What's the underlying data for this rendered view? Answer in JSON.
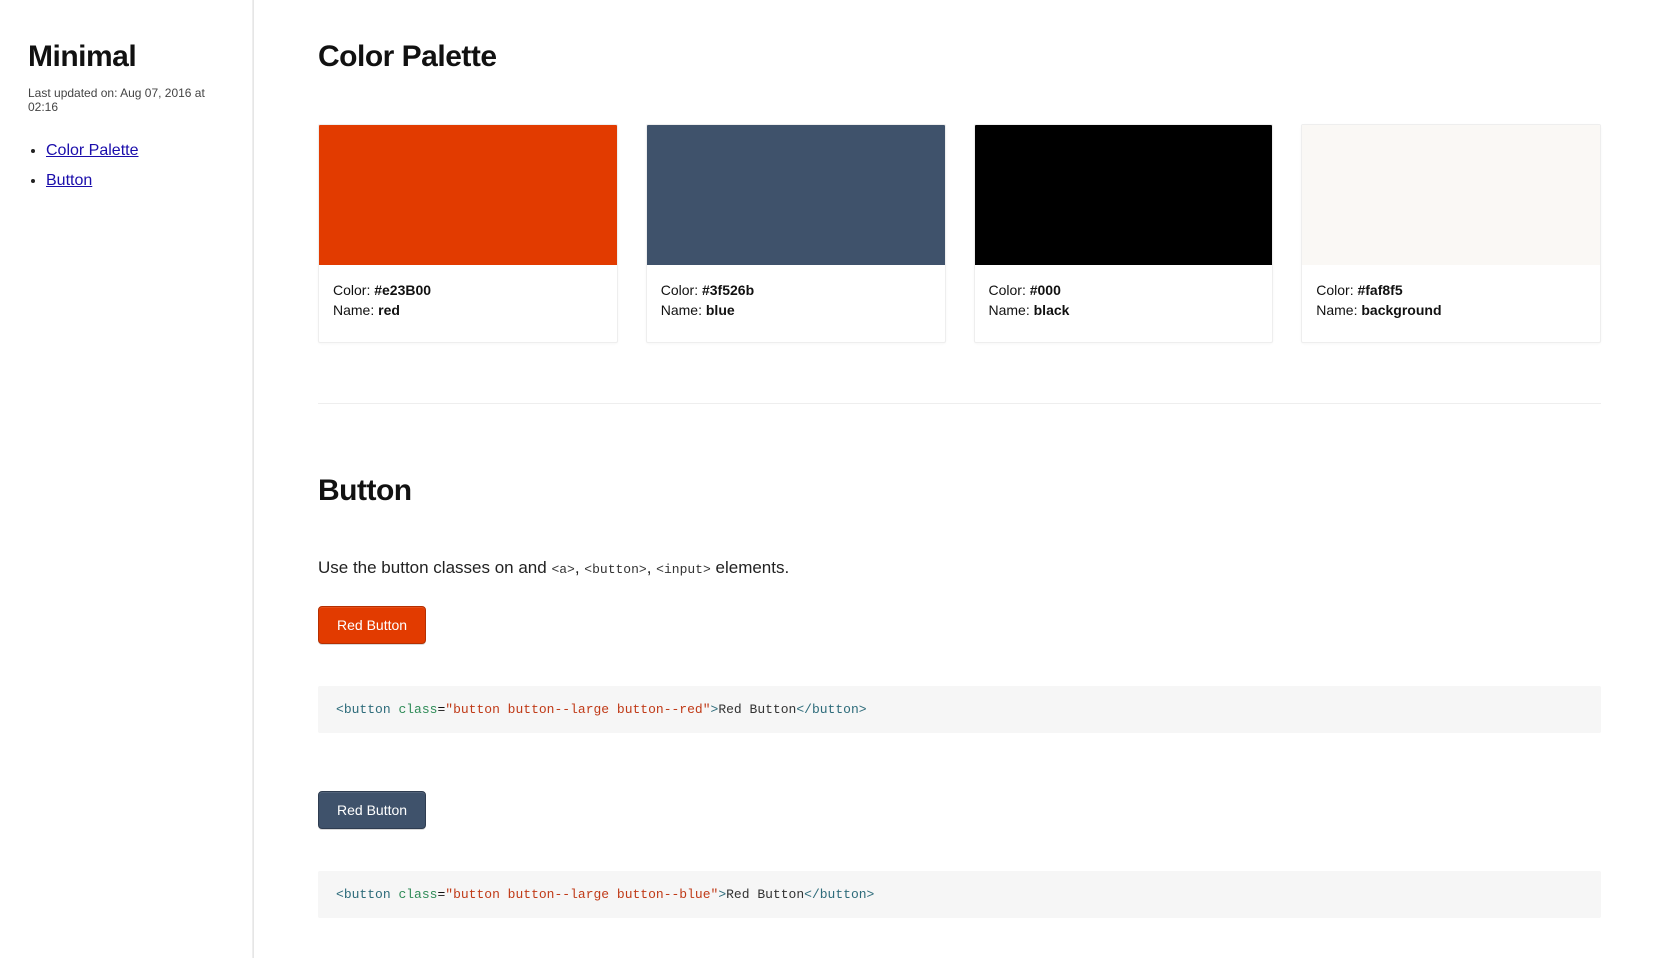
{
  "sidebar": {
    "title": "Minimal",
    "updated": "Last updated on: Aug 07, 2016 at 02:16",
    "nav": [
      {
        "label": "Color Palette"
      },
      {
        "label": "Button"
      }
    ]
  },
  "sections": {
    "palette": {
      "heading": "Color Palette",
      "label_color": "Color: ",
      "label_name": "Name: ",
      "swatches": [
        {
          "hex": "#e23B00",
          "name": "red"
        },
        {
          "hex": "#3f526b",
          "name": "blue"
        },
        {
          "hex": "#000",
          "name": "black"
        },
        {
          "hex": "#faf8f5",
          "name": "background"
        }
      ]
    },
    "button": {
      "heading": "Button",
      "desc_pre": "Use the button classes on and ",
      "desc_code1": "<a>",
      "desc_sep1": ", ",
      "desc_code2": "<button>",
      "desc_sep2": ", ",
      "desc_code3": "<input>",
      "desc_post": " elements.",
      "examples": [
        {
          "label": "Red Button",
          "variant": "red",
          "code": {
            "open_lt": "<",
            "tag": "button",
            "space": " ",
            "attr": "class",
            "eq": "=",
            "str": "\"button button--large button--red\"",
            "gt": ">",
            "text": "Red Button",
            "close": "</button>"
          }
        },
        {
          "label": "Red Button",
          "variant": "blue",
          "code": {
            "open_lt": "<",
            "tag": "button",
            "space": " ",
            "attr": "class",
            "eq": "=",
            "str": "\"button button--large button--blue\"",
            "gt": ">",
            "text": "Red Button",
            "close": "</button>"
          }
        }
      ]
    }
  }
}
